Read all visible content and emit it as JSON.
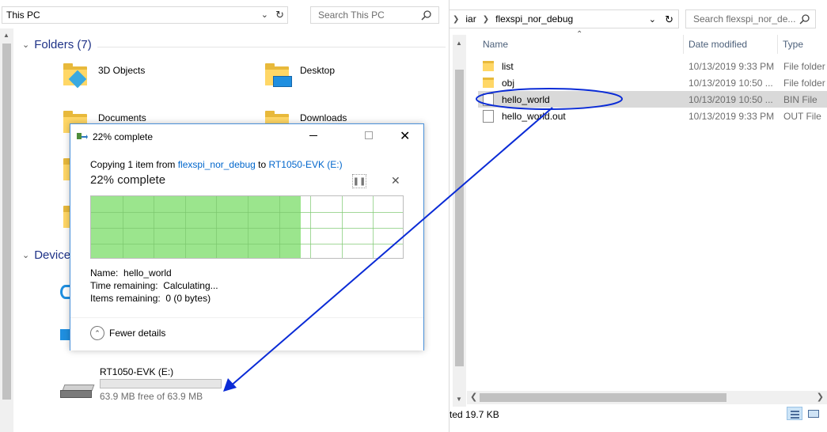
{
  "left": {
    "address": "This PC",
    "search_placeholder": "Search This PC",
    "folders_header": "Folders (7)",
    "devices_header": "Device",
    "folders": [
      {
        "label": "3D Objects"
      },
      {
        "label": "Desktop"
      },
      {
        "label": "Documents"
      },
      {
        "label": "Downloads"
      }
    ],
    "drive": {
      "name": "RT1050-EVK (E:)",
      "free": "63.9 MB free of 63.9 MB",
      "used_fraction": 0
    }
  },
  "right": {
    "breadcrumb": [
      "iar",
      "flexspi_nor_debug"
    ],
    "search_placeholder": "Search flexspi_nor_de...",
    "columns": {
      "name": "Name",
      "date": "Date modified",
      "type": "Type"
    },
    "files": [
      {
        "name": "list",
        "date": "10/13/2019 9:33 PM",
        "type": "File folder",
        "icon": "folder-icon"
      },
      {
        "name": "obj",
        "date": "10/13/2019 10:50 ...",
        "type": "File folder",
        "icon": "folder-icon"
      },
      {
        "name": "hello_world",
        "date": "10/13/2019 10:50 ...",
        "type": "BIN File",
        "icon": "file-icon"
      },
      {
        "name": "hello_world.out",
        "date": "10/13/2019 9:33 PM",
        "type": "OUT File",
        "icon": "file-icon"
      }
    ],
    "status": "ted  19.7 KB"
  },
  "dialog": {
    "title": "22% complete",
    "copy_prefix": "Copying 1 item from ",
    "source": "flexspi_nor_debug",
    "to_word": " to ",
    "dest": "RT1050-EVK (E:)",
    "percent_text": "22% complete",
    "progress_fraction": 0.67,
    "name_label": "Name:",
    "name_value": "hello_world",
    "time_label": "Time remaining:",
    "time_value": "Calculating...",
    "items_label": "Items remaining:",
    "items_value": "0 (0 bytes)",
    "fewer_details": "Fewer details"
  },
  "colors": {
    "accent_link": "#0066cc",
    "progress_fill": "#9be58d",
    "annotation": "#0a2bd6"
  }
}
